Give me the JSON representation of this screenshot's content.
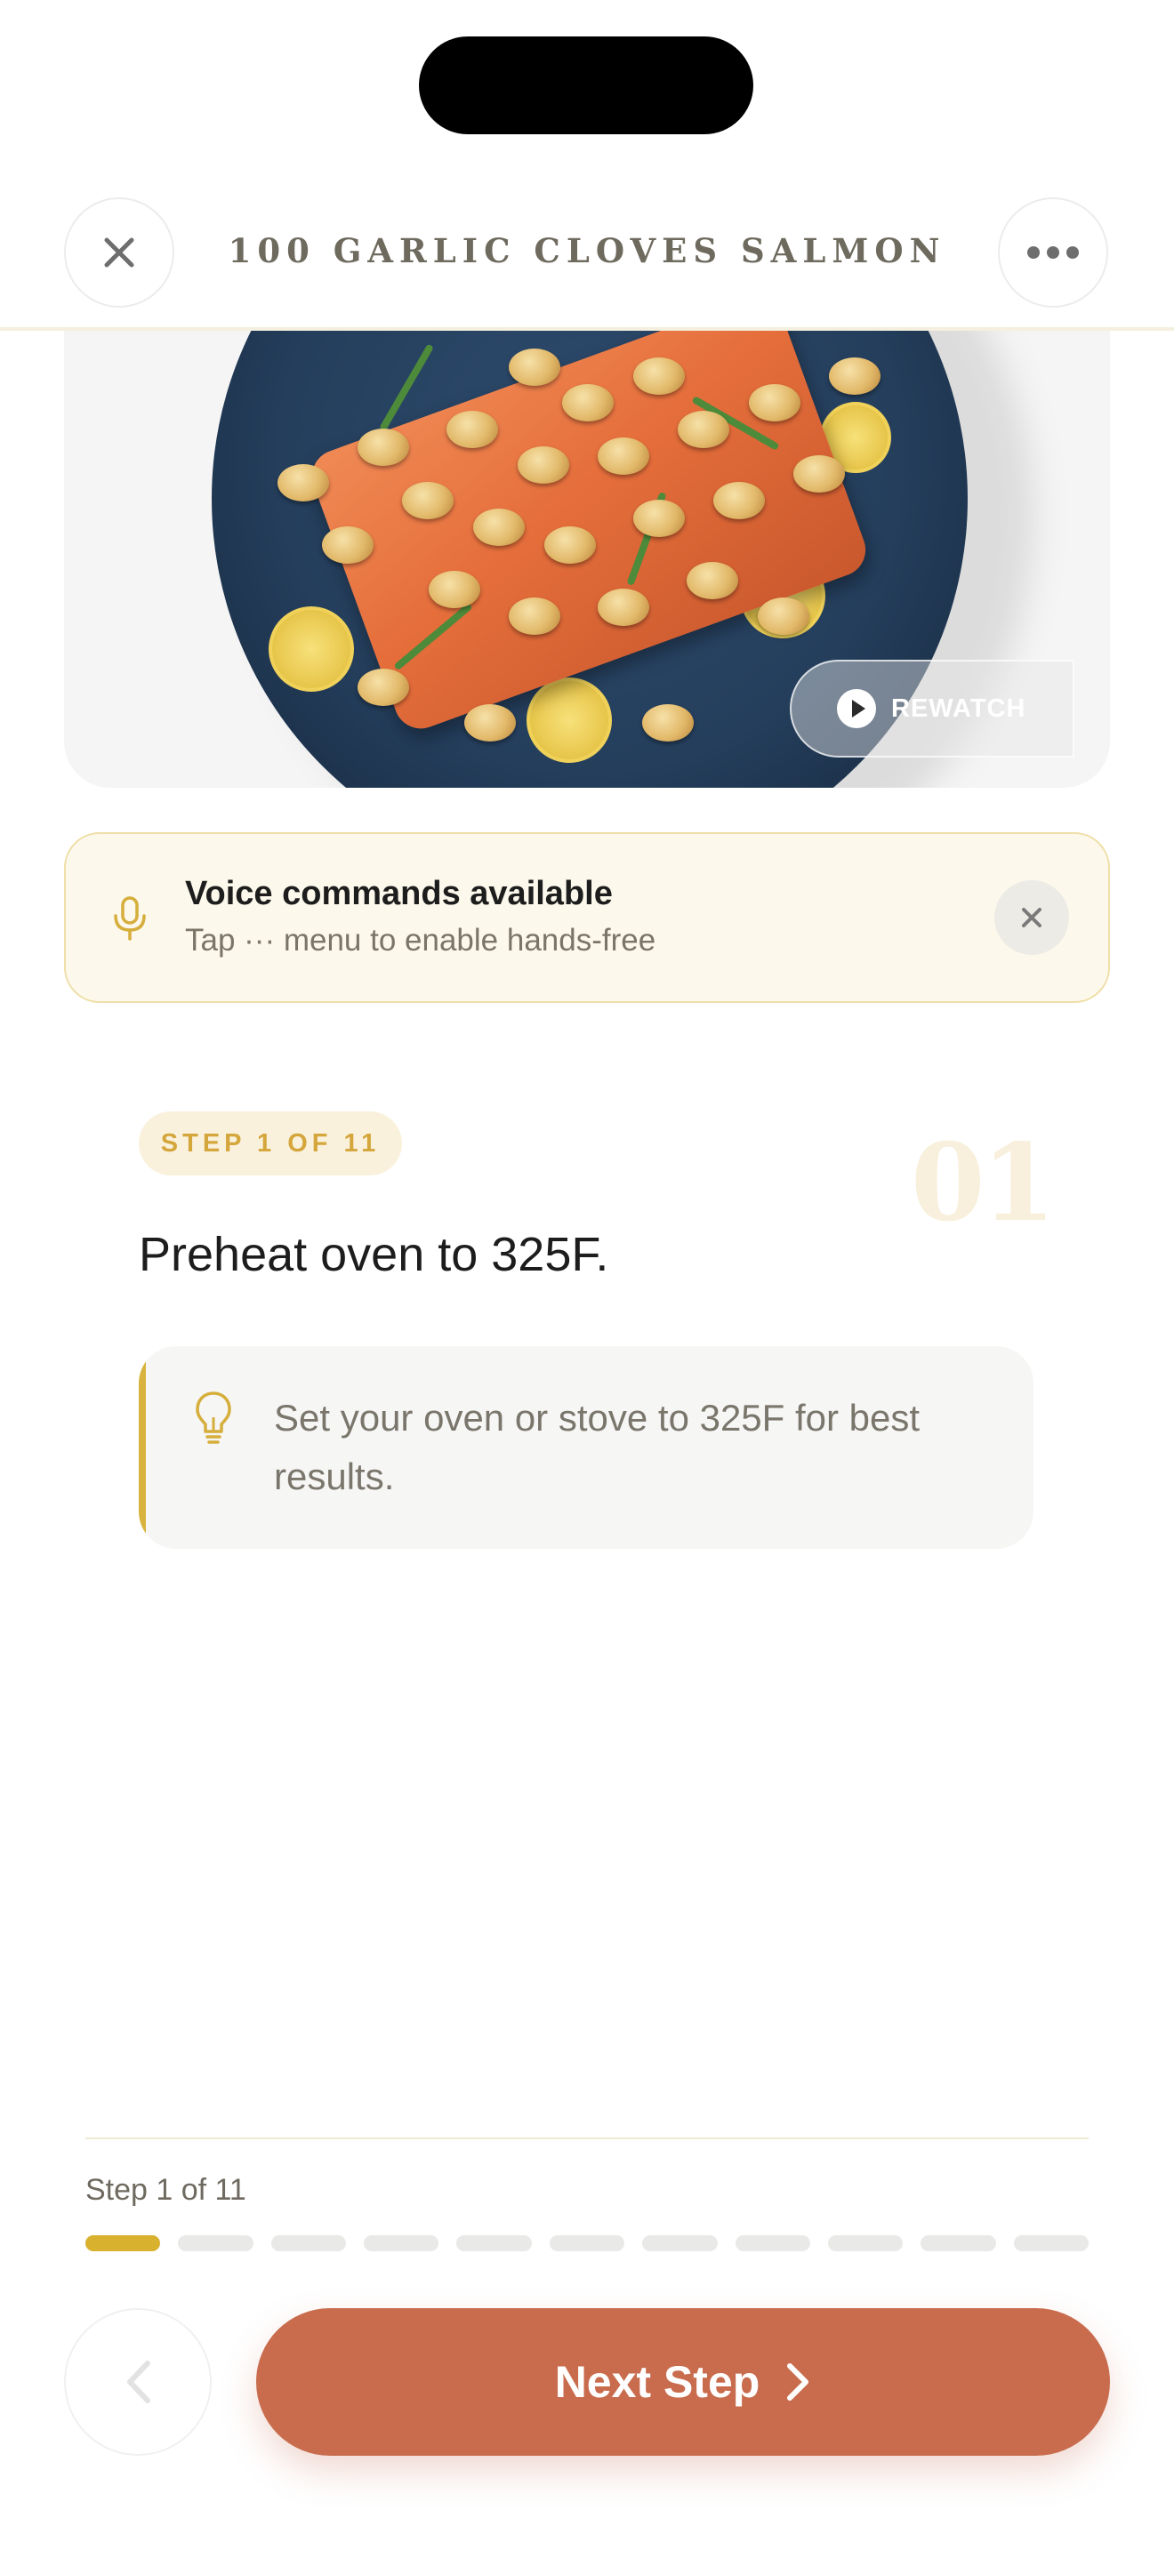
{
  "header": {
    "title": "100 GARLIC CLOVES SALMON",
    "close_icon": "close-icon",
    "more_icon": "more-horizontal-icon"
  },
  "hero": {
    "rewatch_label": "REWATCH",
    "rewatch_icon": "play-icon"
  },
  "voice_banner": {
    "title": "Voice commands available",
    "subtitle": "Tap ··· menu to enable hands-free",
    "icon": "microphone-icon",
    "dismiss_icon": "close-icon"
  },
  "step": {
    "badge": "STEP 1 OF 11",
    "big_number": "01",
    "instruction": "Preheat oven to 325F.",
    "tip_icon": "lightbulb-icon",
    "tip": "Set your oven or stove to 325F for best results."
  },
  "progress": {
    "label": "Step 1 of 11",
    "current": 1,
    "total": 11
  },
  "nav": {
    "next_label": "Next Step",
    "next_icon": "chevron-right-icon",
    "prev_icon": "chevron-left-icon"
  },
  "colors": {
    "accent_gold": "#d8b12f",
    "next_button": "#c96c4e",
    "banner_bg": "#fcf8ec"
  }
}
